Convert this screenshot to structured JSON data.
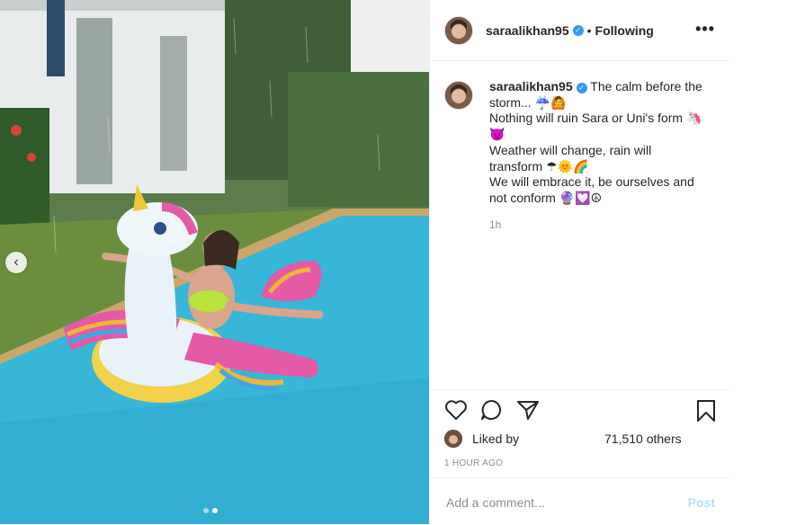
{
  "post": {
    "username": "saraalikhan95",
    "separator": "•",
    "follow_status": "Following",
    "more_glyph": "•••",
    "caption": {
      "line1": "The calm before the storm... ☔🙆",
      "line2": "Nothing will ruin Sara or Uni's form 🦄😈",
      "line3": "Weather will change, rain will transform ☂🌞🌈",
      "line4": "We will embrace it, be ourselves and not conform 🔮💟☮"
    },
    "caption_time": "1h",
    "liked_by_label": "Liked by",
    "likes_count": "71,510 others",
    "timestamp": "1 HOUR AGO",
    "comment_placeholder": "Add a comment...",
    "post_label": "Post"
  },
  "carousel": {
    "prev_glyph": "‹",
    "slide_count": 2,
    "active_index": 1
  },
  "icons": {
    "like": "heart-icon",
    "comment": "comment-icon",
    "share": "share-icon",
    "save": "bookmark-icon",
    "verified": "verified-badge-icon"
  },
  "colors": {
    "verified": "#3897f0",
    "post_disabled": "#b2dffc",
    "muted": "#8e8e8e"
  }
}
